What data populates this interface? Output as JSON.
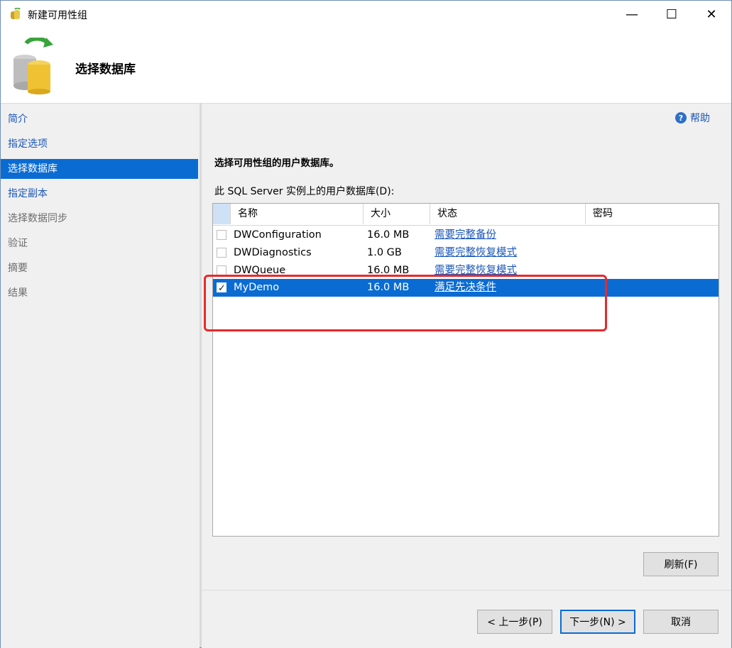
{
  "window": {
    "title": "新建可用性组",
    "min_glyph": "—",
    "max_glyph": "☐",
    "close_glyph": "✕"
  },
  "header": {
    "title": "选择数据库"
  },
  "nav": {
    "items": [
      {
        "label": "简介",
        "state": "link"
      },
      {
        "label": "指定选项",
        "state": "link"
      },
      {
        "label": "选择数据库",
        "state": "selected"
      },
      {
        "label": "指定副本",
        "state": "link"
      },
      {
        "label": "选择数据同步",
        "state": "disabled"
      },
      {
        "label": "验证",
        "state": "disabled"
      },
      {
        "label": "摘要",
        "state": "disabled"
      },
      {
        "label": "结果",
        "state": "disabled"
      }
    ]
  },
  "main": {
    "help_label": "帮助",
    "section_title": "选择可用性组的用户数据库。",
    "list_label": "此 SQL Server 实例上的用户数据库(D):",
    "columns": [
      "名称",
      "大小",
      "状态",
      "密码"
    ],
    "rows": [
      {
        "name": "DWConfiguration",
        "size": "16.0 MB",
        "status": "需要完整备份",
        "checked": false
      },
      {
        "name": "DWDiagnostics",
        "size": "1.0 GB",
        "status": "需要完整恢复模式",
        "checked": false
      },
      {
        "name": "DWQueue",
        "size": "16.0 MB",
        "status": "需要完整恢复模式",
        "checked": false
      },
      {
        "name": "MyDemo",
        "size": "16.0 MB",
        "status": "满足先决条件",
        "checked": true
      }
    ],
    "refresh_label": "刷新(F)"
  },
  "footer": {
    "back_label": "< 上一步(P)",
    "next_label": "下一步(N) >",
    "cancel_label": "取消"
  },
  "colors": {
    "accent": "#0a6cd2",
    "link": "#1a56b8",
    "highlight": "#e8292b"
  }
}
